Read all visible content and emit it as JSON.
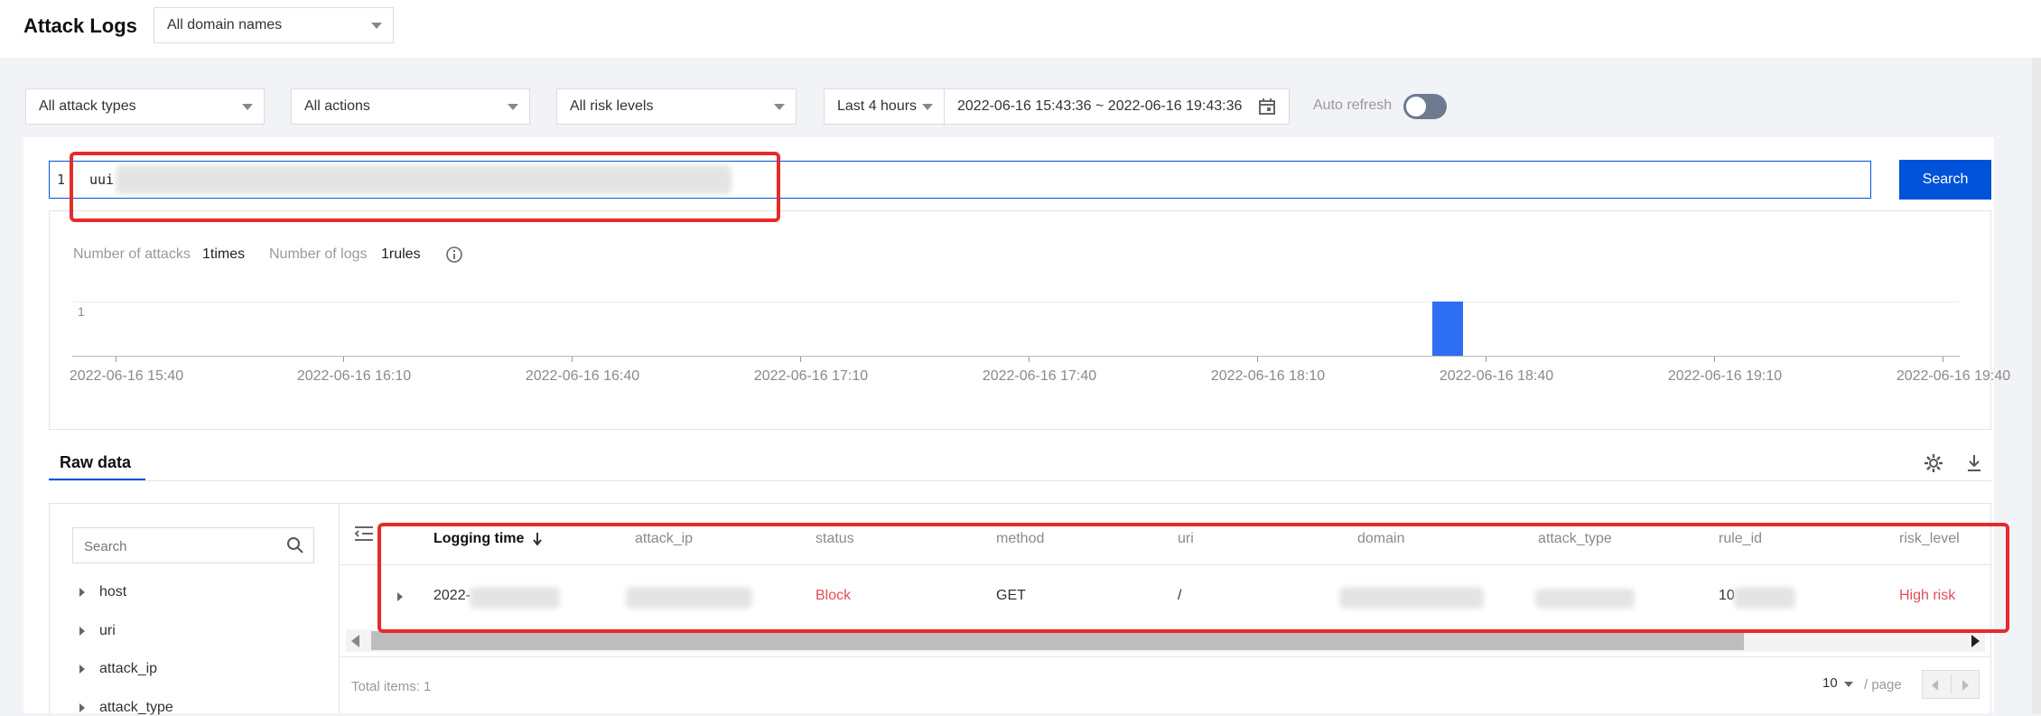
{
  "header": {
    "title": "Attack Logs",
    "domain_select": "All domain names"
  },
  "filters": {
    "attack_types": "All attack types",
    "actions": "All actions",
    "risk_levels": "All risk levels",
    "time_range": "Last 4 hours",
    "date_range": "2022-06-16 15:43:36 ~ 2022-06-16 19:43:36",
    "auto_refresh_label": "Auto refresh"
  },
  "query": {
    "line_number": "1",
    "text": "uui",
    "search_button": "Search"
  },
  "stats": {
    "attacks_label": "Number of attacks",
    "attacks_value": "1times",
    "logs_label": "Number of logs",
    "logs_value": "1rules"
  },
  "chart_data": {
    "type": "bar",
    "ylim": [
      0,
      1
    ],
    "y_tick_label": "1",
    "x_ticks": [
      "2022-06-16 15:40",
      "2022-06-16 16:10",
      "2022-06-16 16:40",
      "2022-06-16 17:10",
      "2022-06-16 17:40",
      "2022-06-16 18:10",
      "2022-06-16 18:40",
      "2022-06-16 19:10",
      "2022-06-16 19:40"
    ],
    "bars": [
      {
        "x": "2022-06-16 18:35",
        "value": 1
      }
    ],
    "colors": {
      "bar": "#2e6ef5"
    }
  },
  "raw": {
    "tab": "Raw data",
    "search_placeholder": "Search",
    "fields": [
      "host",
      "uri",
      "attack_ip",
      "attack_type"
    ],
    "columns": [
      "Logging time",
      "attack_ip",
      "status",
      "method",
      "uri",
      "domain",
      "attack_type",
      "rule_id",
      "risk_level"
    ],
    "row": {
      "logging_time": "2022-",
      "status": "Block",
      "method": "GET",
      "uri": "/",
      "rule_id": "10",
      "risk_level": "High risk"
    },
    "total_items": "Total items: 1",
    "page_size": "10",
    "per_page": "/ page"
  },
  "colors": {
    "accent": "#0052d9",
    "danger": "#e34d59",
    "highlight": "#e52b2b"
  }
}
